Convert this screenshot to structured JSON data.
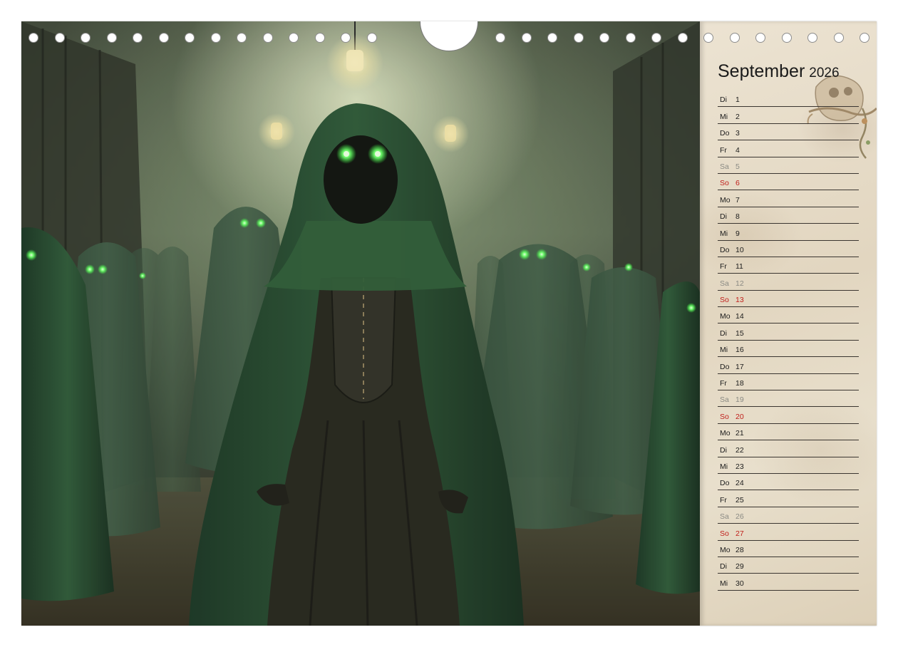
{
  "calendar": {
    "month": "September",
    "year": "2026",
    "days": [
      {
        "weekday": "Di",
        "day": "1",
        "type": "weekday"
      },
      {
        "weekday": "Mi",
        "day": "2",
        "type": "weekday"
      },
      {
        "weekday": "Do",
        "day": "3",
        "type": "weekday"
      },
      {
        "weekday": "Fr",
        "day": "4",
        "type": "weekday"
      },
      {
        "weekday": "Sa",
        "day": "5",
        "type": "saturday"
      },
      {
        "weekday": "So",
        "day": "6",
        "type": "sunday"
      },
      {
        "weekday": "Mo",
        "day": "7",
        "type": "weekday"
      },
      {
        "weekday": "Di",
        "day": "8",
        "type": "weekday"
      },
      {
        "weekday": "Mi",
        "day": "9",
        "type": "weekday"
      },
      {
        "weekday": "Do",
        "day": "10",
        "type": "weekday"
      },
      {
        "weekday": "Fr",
        "day": "11",
        "type": "weekday"
      },
      {
        "weekday": "Sa",
        "day": "12",
        "type": "saturday"
      },
      {
        "weekday": "So",
        "day": "13",
        "type": "sunday"
      },
      {
        "weekday": "Mo",
        "day": "14",
        "type": "weekday"
      },
      {
        "weekday": "Di",
        "day": "15",
        "type": "weekday"
      },
      {
        "weekday": "Mi",
        "day": "16",
        "type": "weekday"
      },
      {
        "weekday": "Do",
        "day": "17",
        "type": "weekday"
      },
      {
        "weekday": "Fr",
        "day": "18",
        "type": "weekday"
      },
      {
        "weekday": "Sa",
        "day": "19",
        "type": "saturday"
      },
      {
        "weekday": "So",
        "day": "20",
        "type": "sunday"
      },
      {
        "weekday": "Mo",
        "day": "21",
        "type": "weekday"
      },
      {
        "weekday": "Di",
        "day": "22",
        "type": "weekday"
      },
      {
        "weekday": "Mi",
        "day": "23",
        "type": "weekday"
      },
      {
        "weekday": "Do",
        "day": "24",
        "type": "weekday"
      },
      {
        "weekday": "Fr",
        "day": "25",
        "type": "weekday"
      },
      {
        "weekday": "Sa",
        "day": "26",
        "type": "saturday"
      },
      {
        "weekday": "So",
        "day": "27",
        "type": "sunday"
      },
      {
        "weekday": "Mo",
        "day": "28",
        "type": "weekday"
      },
      {
        "weekday": "Di",
        "day": "29",
        "type": "weekday"
      },
      {
        "weekday": "Mi",
        "day": "30",
        "type": "weekday"
      }
    ]
  },
  "colors": {
    "weekday_text": "#1c1c1c",
    "saturday_text": "#8a8a84",
    "sunday_text": "#c0201c",
    "paper": "#e6dcc8",
    "cloak_green": "#23452a",
    "eye_glow": "#7dff7a"
  },
  "icons": {
    "hanger": "hanger-hole-icon",
    "binding": "binding-hole-icon",
    "ornament": "skull-ornament-icon"
  }
}
